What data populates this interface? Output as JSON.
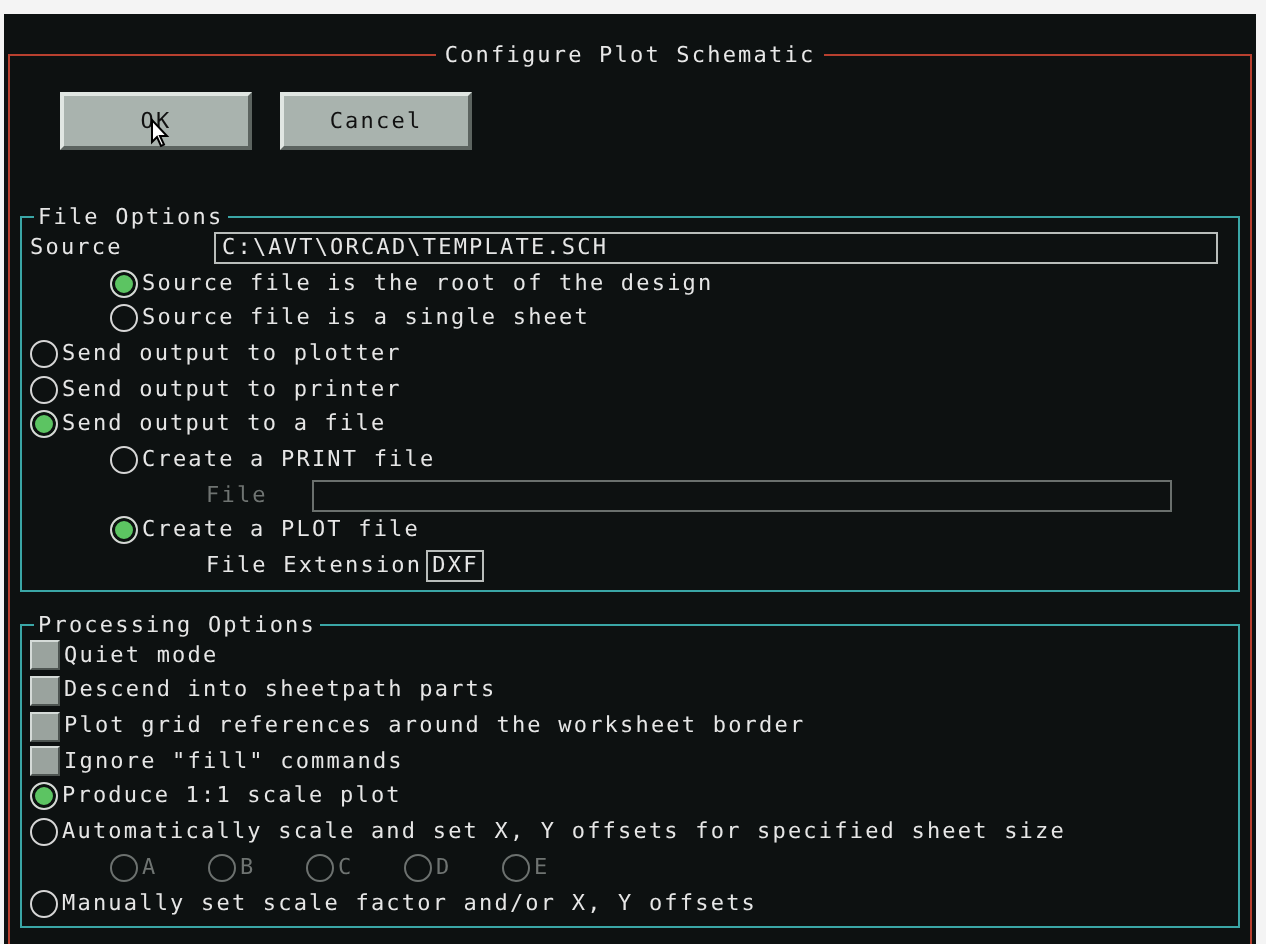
{
  "window": {
    "title": "Configure Plot Schematic"
  },
  "buttons": [
    {
      "label": "OK"
    },
    {
      "label": "Cancel"
    }
  ],
  "file_options": {
    "title": "File Options",
    "source": {
      "label": "Source",
      "value": "C:\\AVT\\ORCAD\\TEMPLATE.SCH"
    },
    "items": [
      {
        "label": "Source file is the root of the design",
        "selected": true
      },
      {
        "label": "Source file is a single sheet",
        "selected": false
      }
    ],
    "outputs": [
      {
        "label": "Send output to plotter",
        "selected": false
      },
      {
        "label": "Send output to printer",
        "selected": false
      },
      {
        "label": "Send output to a file",
        "selected": true
      }
    ],
    "print_file": {
      "label": "Create a PRINT file",
      "selected": false
    },
    "file_field": {
      "label": "File",
      "disabled": true
    },
    "plot_file": {
      "label": "Create a PLOT file",
      "selected": true
    },
    "extension": {
      "label": "File Extension",
      "value": "DXF"
    }
  },
  "processing_options": {
    "title": "Processing Options",
    "items": [
      {
        "kind": "checkbox",
        "label": "Quiet mode",
        "checked": false
      },
      {
        "kind": "checkbox",
        "label": "Descend into sheetpath parts",
        "checked": false
      },
      {
        "kind": "checkbox",
        "label": "Plot grid references around the worksheet border",
        "checked": false
      },
      {
        "kind": "checkbox",
        "label": "Ignore \"fill\" commands",
        "checked": false
      },
      {
        "kind": "radio",
        "label": "Produce 1:1 scale plot",
        "selected": true
      },
      {
        "kind": "radio",
        "label": "Automatically scale and set X, Y offsets for specified sheet size",
        "selected": false
      },
      {
        "kind": "sizes",
        "sizes": [
          {
            "label": "A",
            "selected": false,
            "disabled": true
          },
          {
            "label": "B",
            "selected": false,
            "disabled": true
          },
          {
            "label": "C",
            "selected": false,
            "disabled": true
          },
          {
            "label": "D",
            "selected": false,
            "disabled": true
          },
          {
            "label": "E",
            "selected": false,
            "disabled": true
          }
        ]
      },
      {
        "kind": "radio",
        "label": "Manually set scale factor and/or X, Y offsets",
        "selected": false
      }
    ]
  }
}
